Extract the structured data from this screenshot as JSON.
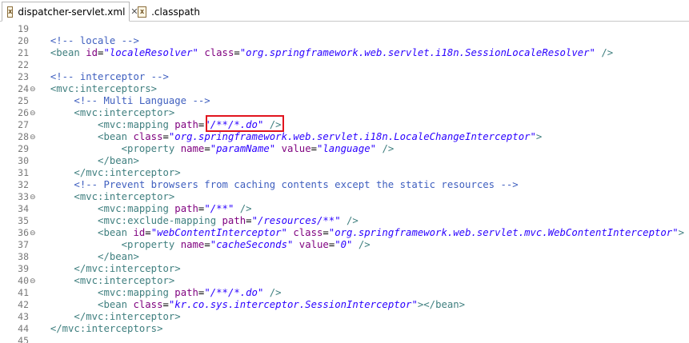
{
  "tabs": [
    {
      "label": "dispatcher-servlet.xml",
      "icon": "xml-file-icon",
      "active": true,
      "close": "✕"
    },
    {
      "label": ".classpath",
      "icon": "xml-file-icon",
      "active": false
    }
  ],
  "lines": [
    {
      "n": "19",
      "fold": false,
      "indent": 0,
      "tokens": []
    },
    {
      "n": "20",
      "fold": false,
      "indent": 2,
      "tokens": [
        [
          "cmt",
          "<!-- locale -->"
        ]
      ]
    },
    {
      "n": "21",
      "fold": false,
      "indent": 2,
      "tokens": [
        [
          "tag",
          "<bean "
        ],
        [
          "attr",
          "id"
        ],
        [
          "txt",
          "="
        ],
        [
          "val",
          "\"localeResolver\""
        ],
        [
          "attr",
          " class"
        ],
        [
          "txt",
          "="
        ],
        [
          "val",
          "\"org.springframework.web.servlet.i18n.SessionLocaleResolver\""
        ],
        [
          "tag",
          " />"
        ]
      ]
    },
    {
      "n": "22",
      "fold": false,
      "indent": 0,
      "tokens": []
    },
    {
      "n": "23",
      "fold": false,
      "indent": 2,
      "tokens": [
        [
          "cmt",
          "<!-- interceptor -->"
        ]
      ]
    },
    {
      "n": "24",
      "fold": true,
      "indent": 2,
      "tokens": [
        [
          "tag",
          "<mvc:interceptors>"
        ]
      ]
    },
    {
      "n": "25",
      "fold": false,
      "indent": 6,
      "tokens": [
        [
          "cmt",
          "<!-- Multi Language -->"
        ]
      ]
    },
    {
      "n": "26",
      "fold": true,
      "indent": 6,
      "tokens": [
        [
          "tag",
          "<mvc:interceptor>"
        ]
      ]
    },
    {
      "n": "27",
      "fold": false,
      "indent": 10,
      "tokens": [
        [
          "tag",
          "<mvc:mapping "
        ],
        [
          "attr",
          "path"
        ],
        [
          "txt",
          "="
        ],
        [
          "val",
          "\"/**/*.do\""
        ],
        [
          "tag",
          " />"
        ]
      ]
    },
    {
      "n": "28",
      "fold": true,
      "indent": 10,
      "tokens": [
        [
          "tag",
          "<bean "
        ],
        [
          "attr",
          "class"
        ],
        [
          "txt",
          "="
        ],
        [
          "val",
          "\"org.springframework.web.servlet.i18n.LocaleChangeInterceptor\""
        ],
        [
          "tag",
          ">"
        ]
      ]
    },
    {
      "n": "29",
      "fold": false,
      "indent": 14,
      "tokens": [
        [
          "tag",
          "<property "
        ],
        [
          "attr",
          "name"
        ],
        [
          "txt",
          "="
        ],
        [
          "val",
          "\"paramName\""
        ],
        [
          "attr",
          " value"
        ],
        [
          "txt",
          "="
        ],
        [
          "val",
          "\"language\""
        ],
        [
          "tag",
          " />"
        ]
      ]
    },
    {
      "n": "30",
      "fold": false,
      "indent": 10,
      "tokens": [
        [
          "tag",
          "</bean>"
        ]
      ]
    },
    {
      "n": "31",
      "fold": false,
      "indent": 6,
      "tokens": [
        [
          "tag",
          "</mvc:interceptor>"
        ]
      ]
    },
    {
      "n": "32",
      "fold": false,
      "indent": 6,
      "tokens": [
        [
          "cmt",
          "<!-- Prevent browsers from caching contents except the static resources -->"
        ]
      ]
    },
    {
      "n": "33",
      "fold": true,
      "indent": 6,
      "tokens": [
        [
          "tag",
          "<mvc:interceptor>"
        ]
      ]
    },
    {
      "n": "34",
      "fold": false,
      "indent": 10,
      "tokens": [
        [
          "tag",
          "<mvc:mapping "
        ],
        [
          "attr",
          "path"
        ],
        [
          "txt",
          "="
        ],
        [
          "val",
          "\"/**\""
        ],
        [
          "tag",
          " />"
        ]
      ]
    },
    {
      "n": "35",
      "fold": false,
      "indent": 10,
      "tokens": [
        [
          "tag",
          "<mvc:exclude-mapping "
        ],
        [
          "attr",
          "path"
        ],
        [
          "txt",
          "="
        ],
        [
          "val",
          "\"/resources/**\""
        ],
        [
          "tag",
          " />"
        ]
      ]
    },
    {
      "n": "36",
      "fold": true,
      "indent": 10,
      "tokens": [
        [
          "tag",
          "<bean "
        ],
        [
          "attr",
          "id"
        ],
        [
          "txt",
          "="
        ],
        [
          "val",
          "\"webContentInterceptor\""
        ],
        [
          "attr",
          " class"
        ],
        [
          "txt",
          "="
        ],
        [
          "val",
          "\"org.springframework.web.servlet.mvc.WebContentInterceptor\""
        ],
        [
          "tag",
          ">"
        ]
      ]
    },
    {
      "n": "37",
      "fold": false,
      "indent": 14,
      "tokens": [
        [
          "tag",
          "<property "
        ],
        [
          "attr",
          "name"
        ],
        [
          "txt",
          "="
        ],
        [
          "val",
          "\"cacheSeconds\""
        ],
        [
          "attr",
          " value"
        ],
        [
          "txt",
          "="
        ],
        [
          "val",
          "\"0\""
        ],
        [
          "tag",
          " />"
        ]
      ]
    },
    {
      "n": "38",
      "fold": false,
      "indent": 10,
      "tokens": [
        [
          "tag",
          "</bean>"
        ]
      ]
    },
    {
      "n": "39",
      "fold": false,
      "indent": 6,
      "tokens": [
        [
          "tag",
          "</mvc:interceptor>"
        ]
      ]
    },
    {
      "n": "40",
      "fold": true,
      "indent": 6,
      "tokens": [
        [
          "tag",
          "<mvc:interceptor>"
        ]
      ]
    },
    {
      "n": "41",
      "fold": false,
      "indent": 10,
      "tokens": [
        [
          "tag",
          "<mvc:mapping "
        ],
        [
          "attr",
          "path"
        ],
        [
          "txt",
          "="
        ],
        [
          "val",
          "\"/**/*.do\""
        ],
        [
          "tag",
          " />"
        ]
      ]
    },
    {
      "n": "42",
      "fold": false,
      "indent": 10,
      "tokens": [
        [
          "tag",
          "<bean "
        ],
        [
          "attr",
          "class"
        ],
        [
          "txt",
          "="
        ],
        [
          "val",
          "\"kr.co.sys.interceptor.SessionInterceptor\""
        ],
        [
          "tag",
          "></bean>"
        ]
      ]
    },
    {
      "n": "43",
      "fold": false,
      "indent": 6,
      "tokens": [
        [
          "tag",
          "</mvc:interceptor>"
        ]
      ]
    },
    {
      "n": "44",
      "fold": false,
      "indent": 2,
      "tokens": [
        [
          "tag",
          "</mvc:interceptors>"
        ]
      ]
    },
    {
      "n": "45",
      "fold": false,
      "indent": 0,
      "tokens": []
    }
  ],
  "fold_marker": "⊖",
  "highlight_color": "#e1141e"
}
